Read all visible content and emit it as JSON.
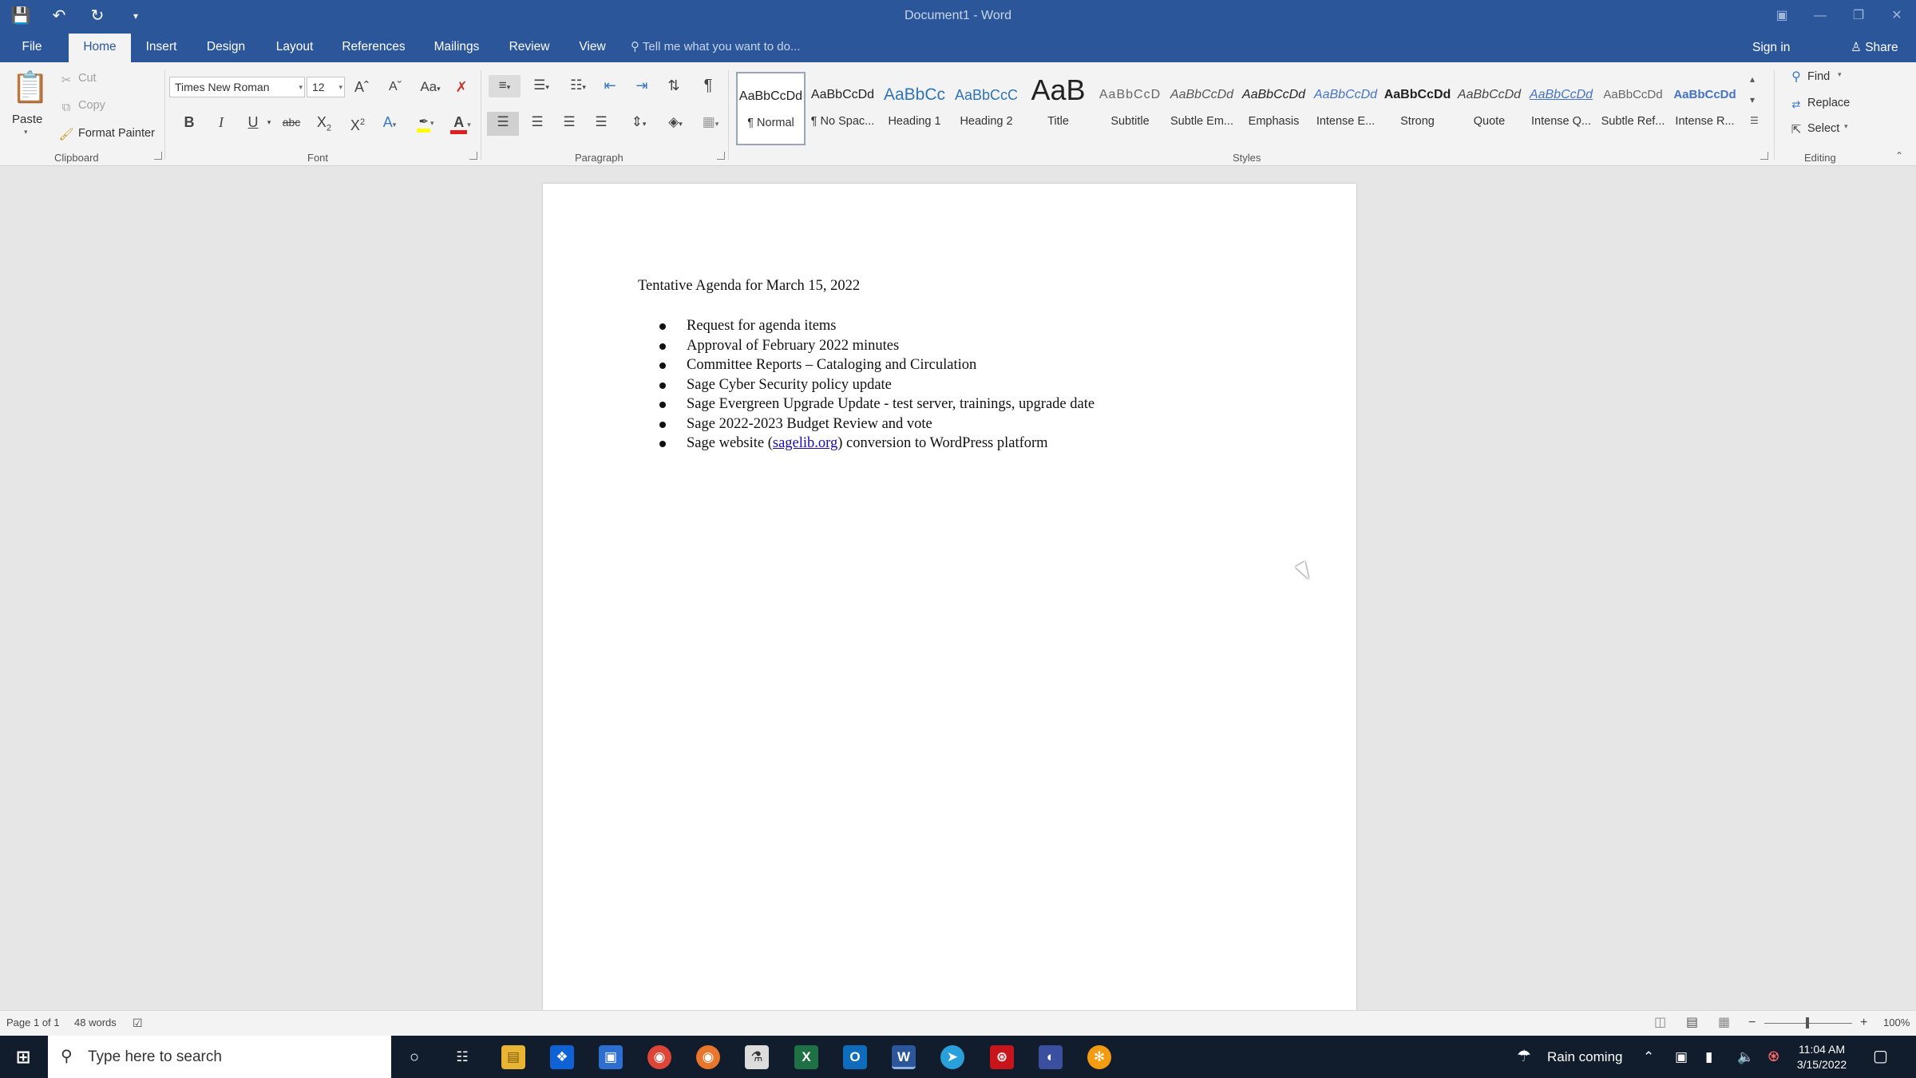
{
  "app": {
    "title": "Document1 - Word"
  },
  "tabs": [
    "File",
    "Home",
    "Insert",
    "Design",
    "Layout",
    "References",
    "Mailings",
    "Review",
    "View"
  ],
  "tell_me": "Tell me what you want to do...",
  "account": {
    "sign_in": "Sign in",
    "share": "Share"
  },
  "ribbon": {
    "clipboard": {
      "paste": "Paste",
      "cut": "Cut",
      "copy": "Copy",
      "format_painter": "Format Painter",
      "label": "Clipboard"
    },
    "font": {
      "name": "Times New Roman",
      "size": "12",
      "change_case": "Aa",
      "label": "Font",
      "bold": "B",
      "italic": "I",
      "underline": "U",
      "strikethrough": "abc",
      "subscript": "X",
      "subscript_mark": "2",
      "superscript": "X",
      "superscript_mark": "2",
      "font_color": "A",
      "text_effects": "A"
    },
    "paragraph": {
      "label": "Paragraph",
      "pilcrow": "¶"
    },
    "styles": {
      "label": "Styles",
      "items": [
        {
          "preview": "AaBbCcDd",
          "name": "¶ Normal"
        },
        {
          "preview": "AaBbCcDd",
          "name": "¶ No Spac..."
        },
        {
          "preview": "AaBbCc",
          "name": "Heading 1"
        },
        {
          "preview": "AaBbCcC",
          "name": "Heading 2"
        },
        {
          "preview": "AaB",
          "name": "Title"
        },
        {
          "preview": "AaBbCcD",
          "name": "Subtitle"
        },
        {
          "preview": "AaBbCcDd",
          "name": "Subtle Em..."
        },
        {
          "preview": "AaBbCcDd",
          "name": "Emphasis"
        },
        {
          "preview": "AaBbCcDd",
          "name": "Intense E..."
        },
        {
          "preview": "AaBbCcDd",
          "name": "Strong"
        },
        {
          "preview": "AaBbCcDd",
          "name": "Quote"
        },
        {
          "preview": "AaBbCcDd",
          "name": "Intense Q..."
        },
        {
          "preview": "AaBbCcDd",
          "name": "Subtle Ref..."
        },
        {
          "preview": "AaBbCcDd",
          "name": "Intense R..."
        }
      ]
    },
    "editing": {
      "find": "Find",
      "replace": "Replace",
      "select": "Select",
      "label": "Editing"
    }
  },
  "document": {
    "heading": "Tentative Agenda for March 15, 2022",
    "items": [
      "Request for agenda items",
      "Approval of February 2022 minutes",
      "Committee Reports – Cataloging and Circulation",
      "Sage Cyber Security policy update",
      "Sage Evergreen Upgrade Update - test server, trainings, upgrade date",
      "Sage 2022-2023 Budget Review and vote"
    ],
    "last_item": {
      "before": "Sage website (",
      "link": "sagelib.org",
      "after": ") conversion to WordPress platform"
    }
  },
  "status": {
    "page": "Page 1 of 1",
    "words": "48 words",
    "zoom": "100%"
  },
  "taskbar": {
    "search_placeholder": "Type here to search",
    "weather": "Rain coming",
    "time": "11:04 AM",
    "date": "3/15/2022"
  },
  "colors": {
    "word_blue": "#2b579a",
    "ribbon_bg": "#f3f3f3",
    "taskbar_bg": "#111d2d"
  }
}
